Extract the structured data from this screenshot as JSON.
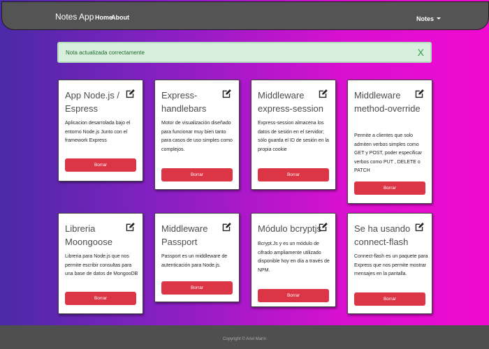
{
  "navbar": {
    "brand": "Notes App",
    "links": [
      "Home",
      "About"
    ],
    "notes_menu": "Notes"
  },
  "alert": {
    "message": "Nota actualizada correctamente",
    "close": "X"
  },
  "cards": [
    {
      "title": "App Node.js / Espress",
      "description": "Aplicacion desarrolada bajo el entorno Node.js Junto con el framework Express",
      "delete_label": "Borrar"
    },
    {
      "title": "Express-handlebars",
      "description": "Motor de visualización diseñado para funcionar muy bien tanto para casos de uso simples como complejos.",
      "delete_label": "Borrar"
    },
    {
      "title": "Middleware express-session",
      "description": "Express-session almacena los datos de sesión en el servidor; sólo guarda el ID de sesión en la propia cookie",
      "delete_label": "Borrar"
    },
    {
      "title": "Middleware method-override",
      "description": "Permite a clientes que solo admiten verbos simples como GET y POST, poder especificar verbos como PUT , DELETE o PATCH",
      "delete_label": "Borrar"
    },
    {
      "title": "Libreria Moongoose",
      "description": "Libreria para Node.js que nos permite escribir consultas para una base de datos de MongooDB",
      "delete_label": "Borrar"
    },
    {
      "title": "Middleware Passport",
      "description": "Passport es un middleware de autenticación para Node.js.",
      "delete_label": "Borrar"
    },
    {
      "title": "Módulo bcryptjs",
      "description": "Bcrypt.Js y es un módulo de cifrado ampliamente utilizado disponible hoy en día a través de NPM.",
      "delete_label": "Borrar"
    },
    {
      "title": "Se ha usando connect-flash",
      "description": "Connect-flash es un paquete para Express que nos permite mostrar mensajes en la pantalla.",
      "delete_label": "Borrar"
    }
  ],
  "footer": {
    "copyright": "Copyright © Ariel Marín"
  },
  "icons": {
    "card_action": "edit-icon",
    "dropdown": "caret-down-icon"
  },
  "colors": {
    "delete_button": "#dc3545",
    "alert_background": "#d7efdc",
    "navbar": "#545454"
  }
}
